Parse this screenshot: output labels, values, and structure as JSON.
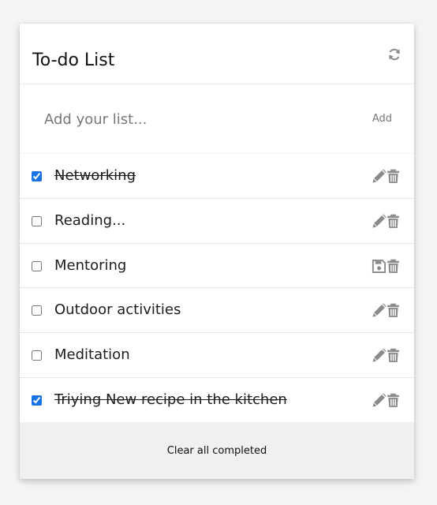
{
  "header": {
    "title": "To-do List",
    "refresh_icon": "refresh-icon"
  },
  "add": {
    "placeholder": "Add your list...",
    "value": "",
    "button_label": "Add"
  },
  "items": [
    {
      "label": "Networking",
      "completed": true,
      "action_icon": "pencil-icon",
      "delete_icon": "trash-icon"
    },
    {
      "label": "Reading...",
      "completed": false,
      "action_icon": "pencil-icon",
      "delete_icon": "trash-icon"
    },
    {
      "label": "Mentoring",
      "completed": false,
      "action_icon": "save-icon",
      "delete_icon": "trash-icon"
    },
    {
      "label": "Outdoor activities",
      "completed": false,
      "action_icon": "pencil-icon",
      "delete_icon": "trash-icon"
    },
    {
      "label": "Meditation",
      "completed": false,
      "action_icon": "pencil-icon",
      "delete_icon": "trash-icon"
    },
    {
      "label": "Triying New recipe in the kitchen",
      "completed": true,
      "action_icon": "pencil-icon",
      "delete_icon": "trash-icon"
    }
  ],
  "footer": {
    "clear_label": "Clear all completed"
  },
  "colors": {
    "icon": "#8a8a8a",
    "checkbox_accent": "#1a73e8",
    "footer_bg": "#f0f0f0"
  }
}
